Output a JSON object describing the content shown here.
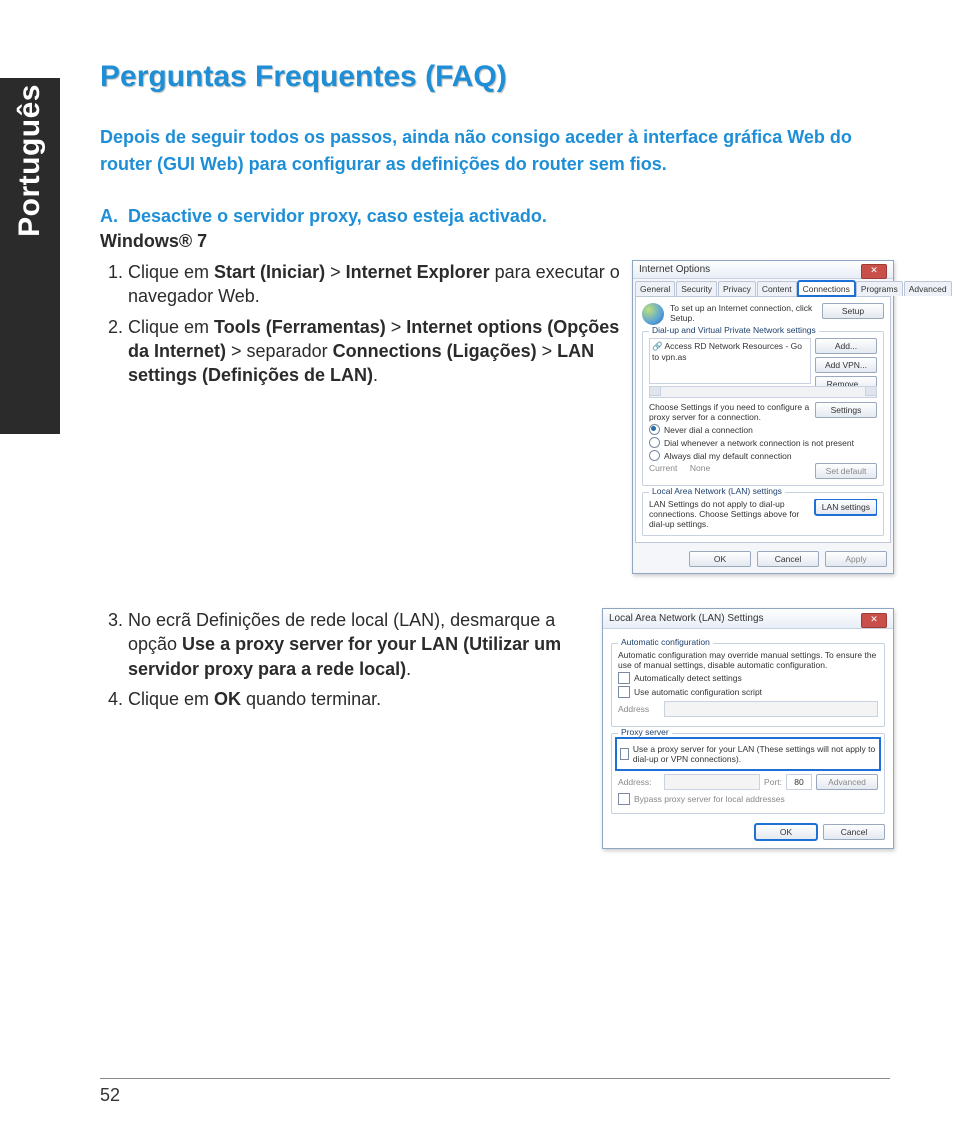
{
  "sideTab": "Português",
  "title": "Perguntas Frequentes (FAQ)",
  "intro": "Depois de seguir todos os passos, ainda não consigo aceder à interface gráfica Web do router (GUI Web) para configurar as definições do router sem fios.",
  "sectionA": {
    "prefix": "A.",
    "text": "Desactive o servidor proxy, caso esteja activado."
  },
  "osHeading": "Windows® 7",
  "steps1": {
    "s1": {
      "t1": "Clique em ",
      "b1": "Start (Iniciar)",
      "t2": " > ",
      "b2": "Internet Explorer",
      "t3": " para executar o navegador Web."
    },
    "s2": {
      "t1": "Clique em ",
      "b1": "Tools (Ferramentas)",
      "t2": " > ",
      "b2": "Internet options (Opções da Internet)",
      "t3": " > separador ",
      "b3": "Connections (Ligações)",
      "t4": " > ",
      "b4": "LAN settings (Definições de LAN)",
      "t5": "."
    }
  },
  "steps2": {
    "s3": {
      "t1": "No ecrã Definições de rede local (LAN), desmarque a opção ",
      "b1": "Use a proxy server for your LAN (Utilizar um servidor proxy para a rede local)",
      "t2": "."
    },
    "s4": {
      "t1": "Clique em ",
      "b1": "OK",
      "t2": " quando terminar."
    }
  },
  "dlg1": {
    "title": "Internet Options",
    "tabs": {
      "general": "General",
      "security": "Security",
      "privacy": "Privacy",
      "content": "Content",
      "connections": "Connections",
      "programs": "Programs",
      "advanced": "Advanced"
    },
    "setupText": "To set up an Internet connection, click Setup.",
    "setupBtn": "Setup",
    "dialGroup": "Dial-up and Virtual Private Network settings",
    "listItem": "Access RD Network Resources - Go to vpn.as",
    "btns": {
      "add": "Add...",
      "addvpn": "Add VPN...",
      "remove": "Remove...",
      "settings": "Settings",
      "setdefault": "Set default",
      "lan": "LAN settings"
    },
    "chooseSettings": "Choose Settings if you need to configure a proxy server for a connection.",
    "radios": {
      "never": "Never dial a connection",
      "whenever": "Dial whenever a network connection is not present",
      "always": "Always dial my default connection"
    },
    "currentLabel": "Current",
    "currentValue": "None",
    "lanGroup": "Local Area Network (LAN) settings",
    "lanNote": "LAN Settings do not apply to dial-up connections. Choose Settings above for dial-up settings.",
    "footer": {
      "ok": "OK",
      "cancel": "Cancel",
      "apply": "Apply"
    }
  },
  "dlg2": {
    "title": "Local Area Network (LAN) Settings",
    "autoGroup": "Automatic configuration",
    "autoNote": "Automatic configuration may override manual settings. To ensure the use of manual settings, disable automatic configuration.",
    "autoDetect": "Automatically detect settings",
    "autoScript": "Use automatic configuration script",
    "addressLabel": "Address",
    "proxyGroup": "Proxy server",
    "proxyUse": "Use a proxy server for your LAN (These settings will not apply to dial-up or VPN connections).",
    "addr2": "Address:",
    "portLabel": "Port:",
    "portValue": "80",
    "advanced": "Advanced",
    "bypass": "Bypass proxy server for local addresses",
    "footer": {
      "ok": "OK",
      "cancel": "Cancel"
    }
  },
  "pageNumber": "52"
}
